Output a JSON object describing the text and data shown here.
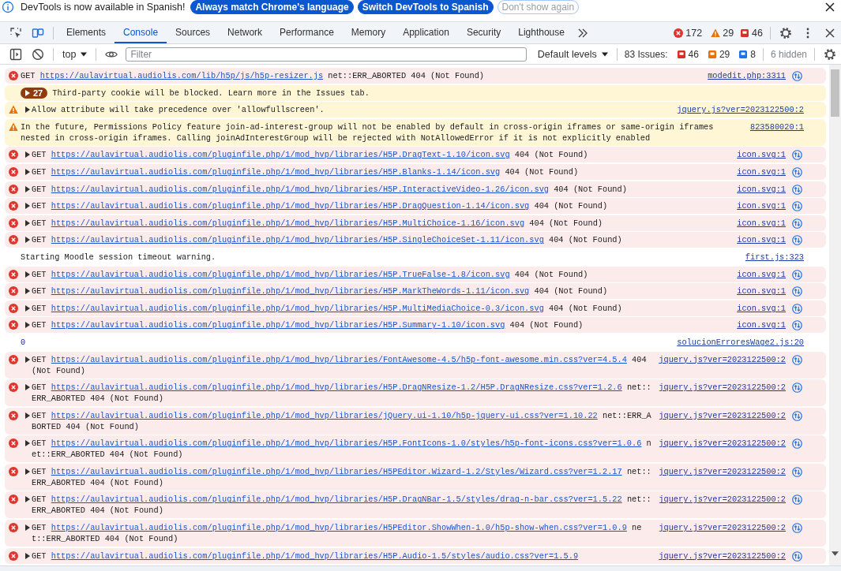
{
  "infobar": {
    "message": "DevTools is now available in Spanish!",
    "buttons": [
      {
        "label": "Always match Chrome's language",
        "kind": "primary"
      },
      {
        "label": "Switch DevTools to Spanish",
        "kind": "primary"
      },
      {
        "label": "Don't show again",
        "kind": "outline"
      }
    ]
  },
  "tabs": [
    {
      "label": "Elements",
      "selected": false
    },
    {
      "label": "Console",
      "selected": true
    },
    {
      "label": "Sources",
      "selected": false
    },
    {
      "label": "Network",
      "selected": false
    },
    {
      "label": "Performance",
      "selected": false
    },
    {
      "label": "Memory",
      "selected": false
    },
    {
      "label": "Application",
      "selected": false
    },
    {
      "label": "Security",
      "selected": false
    },
    {
      "label": "Lighthouse",
      "selected": false
    }
  ],
  "counters": {
    "errors": "172",
    "warnings": "29",
    "issues": "46"
  },
  "toolbar": {
    "context": "top",
    "filter_placeholder": "Filter",
    "levels": "Default levels",
    "issues_label": "83 Issues:",
    "issue_counts": [
      {
        "kind": "error",
        "count": "46"
      },
      {
        "kind": "warning",
        "count": "29"
      },
      {
        "kind": "info",
        "count": "8"
      }
    ],
    "hidden": "6 hidden"
  },
  "messages": [
    {
      "kind": "error",
      "expandable": false,
      "method": "GET",
      "url": "https://aulavirtual.audiolis.com/lib/h5p/js/h5p-resizer.js",
      "text": "net::ERR_ABORTED 404 (Not Found)",
      "source": "modedit.php:3311"
    },
    {
      "kind": "cookie",
      "count": "27",
      "text": "Third-party cookie will be blocked. Learn more in the Issues tab."
    },
    {
      "kind": "warning",
      "expandable": true,
      "text": "Allow attribute will take precedence over 'allowfullscreen'.",
      "source": "jquery.js?ver=2023122500:2"
    },
    {
      "kind": "warning",
      "expandable": false,
      "text": "In the future, Permissions Policy feature join-ad-interest-group will not be enabled by default in cross-origin iframes or same-origin iframes nested in cross-origin iframes. Calling joinAdInterestGroup will be rejected with NotAllowedError if it is not explicitly enabled",
      "source": "823580020:1"
    },
    {
      "kind": "error",
      "expandable": true,
      "method": "GET",
      "url": "https://aulavirtual.audiolis.com/pluginfile.php/1/mod_hvp/libraries/H5P.DragText-1.10/icon.svg",
      "text": "404 (Not Found)",
      "source": "icon.svg:1"
    },
    {
      "kind": "error",
      "expandable": true,
      "method": "GET",
      "url": "https://aulavirtual.audiolis.com/pluginfile.php/1/mod_hvp/libraries/H5P.Blanks-1.14/icon.svg",
      "text": "404 (Not Found)",
      "source": "icon.svg:1"
    },
    {
      "kind": "error",
      "expandable": true,
      "method": "GET",
      "url": "https://aulavirtual.audiolis.com/pluginfile.php/1/mod_hvp/libraries/H5P.InteractiveVideo-1.26/icon.svg",
      "text": "404 (Not Found)",
      "source": "icon.svg:1"
    },
    {
      "kind": "error",
      "expandable": true,
      "method": "GET",
      "url": "https://aulavirtual.audiolis.com/pluginfile.php/1/mod_hvp/libraries/H5P.DragQuestion-1.14/icon.svg",
      "text": "404 (Not Found)",
      "source": "icon.svg:1"
    },
    {
      "kind": "error",
      "expandable": true,
      "method": "GET",
      "url": "https://aulavirtual.audiolis.com/pluginfile.php/1/mod_hvp/libraries/H5P.MultiChoice-1.16/icon.svg",
      "text": "404 (Not Found)",
      "source": "icon.svg:1"
    },
    {
      "kind": "error",
      "expandable": true,
      "method": "GET",
      "url": "https://aulavirtual.audiolis.com/pluginfile.php/1/mod_hvp/libraries/H5P.SingleChoiceSet-1.11/icon.svg",
      "text": "404 (Not Found)",
      "source": "icon.svg:1"
    },
    {
      "kind": "info",
      "text": "Starting Moodle session timeout warning.",
      "source": "first.js:323"
    },
    {
      "kind": "error",
      "expandable": true,
      "method": "GET",
      "url": "https://aulavirtual.audiolis.com/pluginfile.php/1/mod_hvp/libraries/H5P.TrueFalse-1.8/icon.svg",
      "text": "404 (Not Found)",
      "source": "icon.svg:1"
    },
    {
      "kind": "error",
      "expandable": true,
      "method": "GET",
      "url": "https://aulavirtual.audiolis.com/pluginfile.php/1/mod_hvp/libraries/H5P.MarkTheWords-1.11/icon.svg",
      "text": "404 (Not Found)",
      "source": "icon.svg:1"
    },
    {
      "kind": "error",
      "expandable": true,
      "method": "GET",
      "url": "https://aulavirtual.audiolis.com/pluginfile.php/1/mod_hvp/libraries/H5P.MultiMediaChoice-0.3/icon.svg",
      "text": "404 (Not Found)",
      "source": "icon.svg:1"
    },
    {
      "kind": "error",
      "expandable": true,
      "method": "GET",
      "url": "https://aulavirtual.audiolis.com/pluginfile.php/1/mod_hvp/libraries/H5P.Summary-1.10/icon.svg",
      "text": "404 (Not Found)",
      "source": "icon.svg:1"
    },
    {
      "kind": "value",
      "text": "0",
      "source": "solucionErroresWage2.js:20"
    },
    {
      "kind": "error",
      "expandable": true,
      "method": "GET",
      "url": "https://aulavirtual.audiolis.com/pluginfile.php/1/mod_hvp/libraries/FontAwesome-4.5/h5p-font-awesome.min.css?ver=4.5.4",
      "text": "404 (Not Found)",
      "source": "jquery.js?ver=2023122500:2"
    },
    {
      "kind": "error",
      "expandable": true,
      "method": "GET",
      "url": "https://aulavirtual.audiolis.com/pluginfile.php/1/mod_hvp/libraries/H5P.DragNResize-1.2/H5P.DragNResize.css?ver=1.2.6",
      "text": "net::ERR_ABORTED 404 (Not Found)",
      "source": "jquery.js?ver=2023122500:2"
    },
    {
      "kind": "error",
      "expandable": true,
      "method": "GET",
      "url": "https://aulavirtual.audiolis.com/pluginfile.php/1/mod_hvp/libraries/jQuery.ui-1.10/h5p-jquery-ui.css?ver=1.10.22",
      "text": "net::ERR_ABORTED 404 (Not Found)",
      "source": "jquery.js?ver=2023122500:2"
    },
    {
      "kind": "error",
      "expandable": true,
      "method": "GET",
      "url": "https://aulavirtual.audiolis.com/pluginfile.php/1/mod_hvp/libraries/H5P.FontIcons-1.0/styles/h5p-font-icons.css?ver=1.0.6",
      "text": "net::ERR_ABORTED 404 (Not Found)",
      "source": "jquery.js?ver=2023122500:2"
    },
    {
      "kind": "error",
      "expandable": true,
      "method": "GET",
      "url": "https://aulavirtual.audiolis.com/pluginfile.php/1/mod_hvp/libraries/H5PEditor.Wizard-1.2/Styles/Wizard.css?ver=1.2.17",
      "text": "net::ERR_ABORTED 404 (Not Found)",
      "source": "jquery.js?ver=2023122500:2"
    },
    {
      "kind": "error",
      "expandable": true,
      "method": "GET",
      "url": "https://aulavirtual.audiolis.com/pluginfile.php/1/mod_hvp/libraries/H5P.DragNBar-1.5/styles/drag-n-bar.css?ver=1.5.22",
      "text": "net::ERR_ABORTED 404 (Not Found)",
      "source": "jquery.js?ver=2023122500:2"
    },
    {
      "kind": "error",
      "expandable": true,
      "method": "GET",
      "url": "https://aulavirtual.audiolis.com/pluginfile.php/1/mod_hvp/libraries/H5PEditor.ShowWhen-1.0/h5p-show-when.css?ver=1.0.9",
      "text": "net::ERR_ABORTED 404 (Not Found)",
      "source": "jquery.js?ver=2023122500:2"
    },
    {
      "kind": "error",
      "expandable": true,
      "method": "GET",
      "url": "https://aulavirtual.audiolis.com/pluginfile.php/1/mod_hvp/libraries/H5P.Audio-1.5/styles/audio.css?ver=1.5.9",
      "source": "jquery.js?ver=2023122500:2"
    }
  ]
}
